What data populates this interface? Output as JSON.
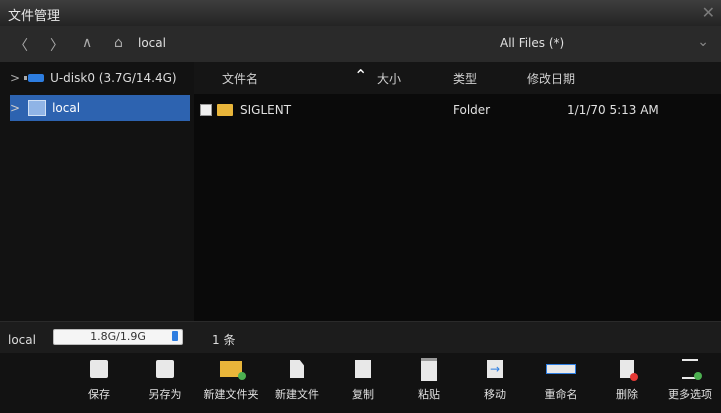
{
  "window": {
    "title": "文件管理",
    "close_glyph": "✕"
  },
  "nav": {
    "back_glyph": "〈",
    "forward_glyph": "〉",
    "up_glyph": "∧",
    "home_glyph": "⌂",
    "path": "local",
    "filter": "All Files (*)",
    "filter_chevron": "⌄"
  },
  "tree": {
    "items": [
      {
        "label": "U-disk0 (3.7G/14.4G)",
        "expand": ">"
      },
      {
        "label": "local",
        "expand": ">"
      }
    ]
  },
  "table": {
    "columns": [
      "文件名",
      "大小",
      "类型",
      "修改日期"
    ],
    "sort_glyph": "⌃",
    "rows": [
      {
        "name": "SIGLENT",
        "size": "",
        "type": "Folder",
        "date": "1/1/70 5:13 AM"
      }
    ]
  },
  "status": {
    "location": "local",
    "storage": "1.8G/1.9G",
    "storage_used_fraction": 0.95,
    "item_count": "1 条"
  },
  "toolbar": {
    "items": [
      "保存",
      "另存为",
      "新建文件夹",
      "新建文件",
      "复制",
      "粘贴",
      "移动",
      "重命名",
      "删除",
      "更多选项"
    ]
  },
  "colors": {
    "accent": "#2d63b0",
    "folder": "#e8b53a"
  }
}
